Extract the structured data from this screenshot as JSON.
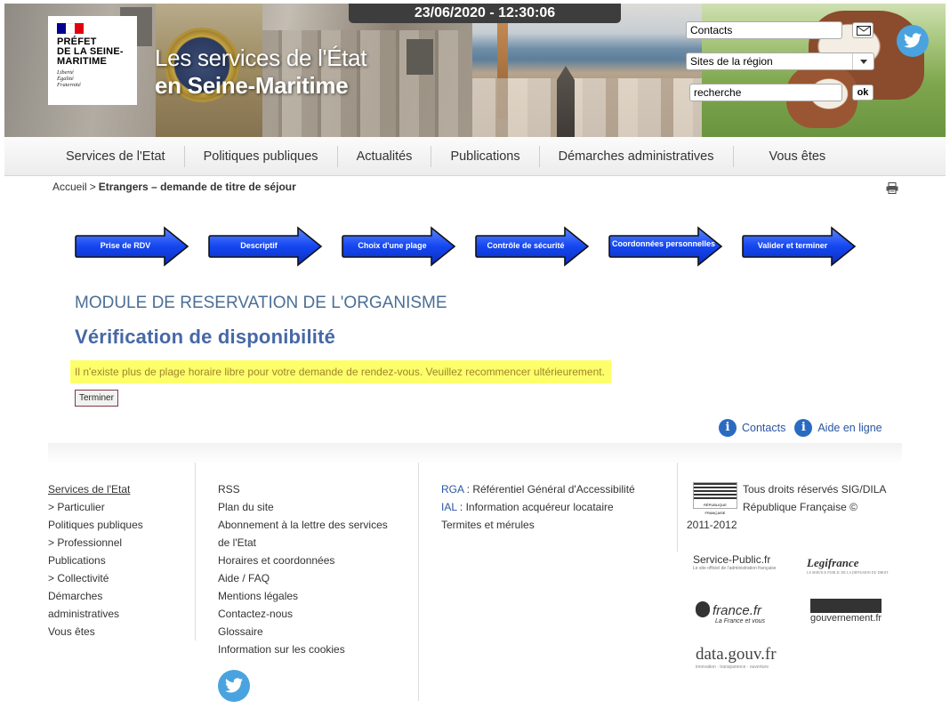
{
  "header": {
    "logo_name": "PRÉFET\nDE LA SEINE-\nMARITIME",
    "logo_motto": "Liberté\nÉgalité\nFraternité",
    "title_line1": "Les services de l'État",
    "title_line2": "en Seine-Maritime",
    "datetime": "23/06/2020 - 12:30:06",
    "contacts_value": "Contacts",
    "region_select_value": "Sites de la région",
    "search_value": "recherche",
    "ok_label": "ok"
  },
  "nav": {
    "items": [
      {
        "label": "Services de l'Etat"
      },
      {
        "label": "Politiques publiques"
      },
      {
        "label": "Actualités"
      },
      {
        "label": "Publications"
      },
      {
        "label": "Démarches administratives"
      },
      {
        "label": "Vous êtes"
      }
    ]
  },
  "breadcrumb": {
    "home": "Accueil",
    "separator": ">",
    "current": "Etrangers – demande de titre de séjour"
  },
  "steps": [
    {
      "label": "Prise de RDV"
    },
    {
      "label": "Descriptif"
    },
    {
      "label": "Choix d'une plage"
    },
    {
      "label": "Contrôle de sécurité"
    },
    {
      "label": "Coordonnées personnelles"
    },
    {
      "label": "Valider et terminer"
    }
  ],
  "main": {
    "module_title": "MODULE DE RESERVATION DE L'ORGANISME",
    "heading": "Vérification de disponibilité",
    "alert": "Il n'existe plus de plage horaire libre pour votre demande de rendez-vous. Veuillez recommencer ultérieurement.",
    "finish_label": "Terminer",
    "help_contacts": "Contacts",
    "help_online": "Aide en ligne"
  },
  "footer": {
    "col1": [
      "Services de l'Etat",
      "> Particulier",
      "Politiques publiques",
      "> Professionnel",
      "Publications",
      "> Collectivité",
      "Démarches",
      "administratives",
      "Vous êtes"
    ],
    "col2": [
      "RSS",
      "Plan du site",
      "Abonnement à la lettre des services",
      "de l'Etat",
      "Horaires et coordonnées",
      "Aide / FAQ",
      "Mentions légales",
      "Contactez-nous",
      "Glossaire",
      "Information sur les cookies"
    ],
    "col3": {
      "rga_acronym": "RGA",
      "rga_text": " : Référentiel Général d'Accessibilité",
      "ial_acronym": "IAL",
      "ial_text": " : Information acquéreur locataire",
      "termites": "Termites et mérules"
    },
    "copyright_line1": "Tous droits réservés SIG/DILA",
    "copyright_line2": "République Française ©",
    "copyright_line3": "2011-2012",
    "rf_logo_text": "RÉPUBLIQUE FRANÇAISE",
    "partners": {
      "service_public": "Service-Public.fr",
      "service_public_tag": "Le site officiel de l'administration française",
      "legifrance": "Legifrance",
      "legifrance_tag": "LE SERVICE PUBLIC DE LA DIFFUSION DU DROIT",
      "france_fr": "france.fr",
      "france_fr_tag": "La France et vous",
      "gouvernement": "gouvernement.fr",
      "data_gouv": "data.gouv.fr",
      "data_gouv_tag": "innovation · transparence · ouverture"
    }
  },
  "colors": {
    "accent_blue": "#4668a6",
    "step_blue": "#1446f0",
    "alert_yellow": "#fcff6a",
    "alert_text": "#a0852b",
    "twitter": "#4aa3df"
  },
  "icons": {
    "mail": "envelope-icon",
    "twitter": "twitter-bird-icon",
    "print": "printer-icon",
    "info": "info-circle-icon",
    "select_arrow": "chevron-down-icon"
  }
}
